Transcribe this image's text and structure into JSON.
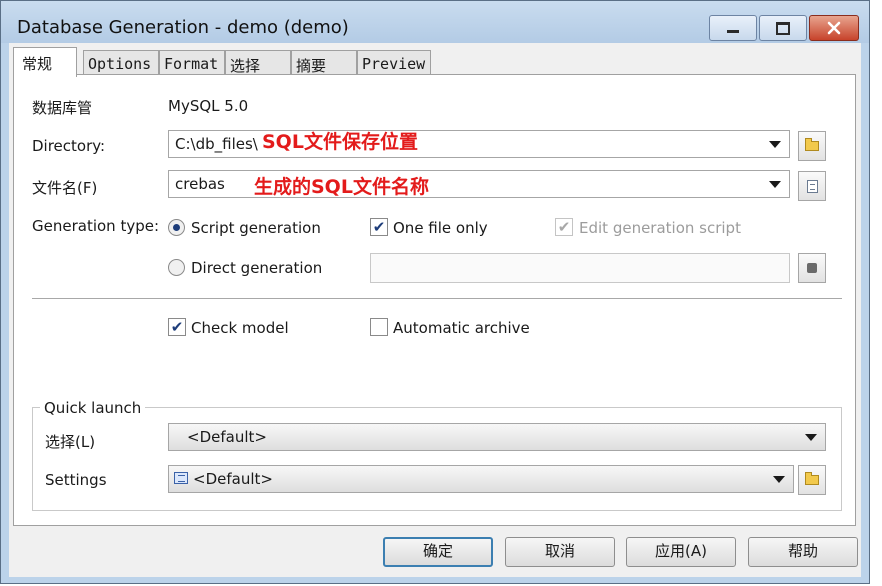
{
  "window": {
    "title": "Database Generation - demo (demo)"
  },
  "tabs": [
    "常规",
    "Options",
    "Format",
    "选择",
    "摘要",
    "Preview"
  ],
  "general": {
    "dbms_label": "数据库管",
    "dbms_value": "MySQL 5.0",
    "directory_label": "Directory:",
    "directory_value": "C:\\db_files\\",
    "directory_annotation": "SQL文件保存位置",
    "filename_label": "文件名(F)",
    "filename_value": "crebas",
    "filename_annotation": "生成的SQL文件名称",
    "gentype_label": "Generation type:",
    "script_generation": "Script generation",
    "direct_generation": "Direct generation",
    "one_file_only": "One file only",
    "edit_generation_script": "Edit generation script",
    "check_model": "Check model",
    "automatic_archive": "Automatic archive",
    "script_generation_selected": true,
    "one_file_only_checked": true,
    "edit_generation_script_checked": true,
    "edit_generation_script_enabled": false,
    "check_model_checked": true,
    "automatic_archive_checked": false
  },
  "quick_launch": {
    "title": "Quick launch",
    "selection_label": "选择(L)",
    "selection_value": "<Default>",
    "settings_label": "Settings",
    "settings_value": "<Default>"
  },
  "buttons": {
    "ok": "确定",
    "cancel": "取消",
    "apply": "应用(A)",
    "help": "帮助"
  },
  "icons": [
    "minimize-icon",
    "maximize-icon",
    "close-icon",
    "folder-icon",
    "document-icon",
    "settings-icon"
  ],
  "colors": {
    "annotation": "#e31b1b",
    "titlebar": "#bcd3ea",
    "close_button": "#c7432b"
  }
}
